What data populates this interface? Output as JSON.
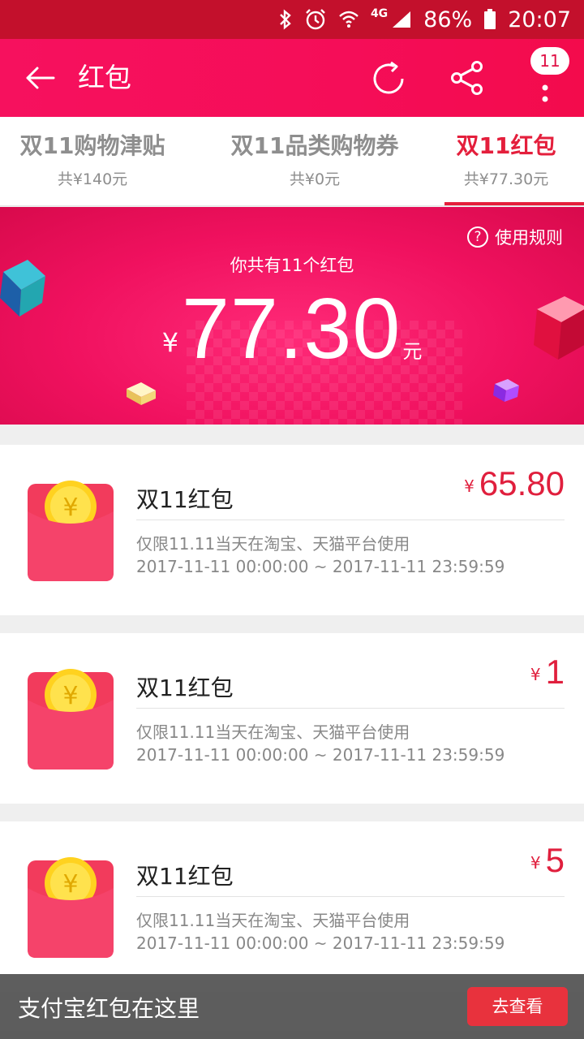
{
  "status_bar": {
    "network": "4G",
    "battery": "86%",
    "time": "20:07",
    "icons": [
      "bluetooth-icon",
      "alarm-icon",
      "wifi-icon",
      "signal-icon",
      "battery-icon"
    ]
  },
  "header": {
    "title": "红包",
    "notification_count": "11",
    "icons": [
      "back-arrow-icon",
      "refresh-icon",
      "share-icon",
      "more-icon"
    ]
  },
  "tabs": [
    {
      "title": "双11购物津贴",
      "subtitle": "共¥140元",
      "active": false
    },
    {
      "title": "双11品类购物券",
      "subtitle": "共¥0元",
      "active": false
    },
    {
      "title": "双11红包",
      "subtitle": "共¥77.30元",
      "active": true
    }
  ],
  "banner": {
    "rules_label": "使用规则",
    "count_text": "你共有11个红包",
    "currency": "¥",
    "amount": "77.30",
    "unit": "元"
  },
  "packets": [
    {
      "title": "双11红包",
      "currency": "¥",
      "amount": "65.80",
      "desc": "仅限11.11当天在淘宝、天猫平台使用",
      "validity": "2017-11-11 00:00:00 ~ 2017-11-11 23:59:59"
    },
    {
      "title": "双11红包",
      "currency": "¥",
      "amount": "1",
      "desc": "仅限11.11当天在淘宝、天猫平台使用",
      "validity": "2017-11-11 00:00:00 ~ 2017-11-11 23:59:59"
    },
    {
      "title": "双11红包",
      "currency": "¥",
      "amount": "5",
      "desc": "仅限11.11当天在淘宝、天猫平台使用",
      "validity": "2017-11-11 00:00:00 ~ 2017-11-11 23:59:59"
    }
  ],
  "alipay_bar": {
    "text": "支付宝红包在这里",
    "button": "去查看"
  },
  "colors": {
    "brand_red": "#e41f3c",
    "header_pink": "#f50d58",
    "status_red": "#c3102c"
  }
}
